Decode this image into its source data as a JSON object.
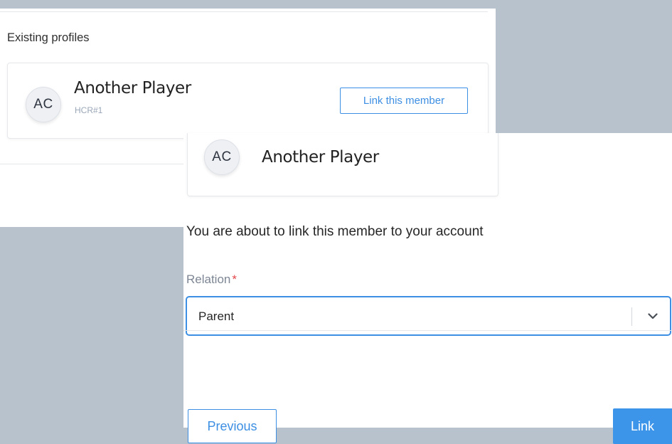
{
  "existing_profiles": {
    "section_title": "Existing profiles",
    "profile": {
      "initials": "AC",
      "name": "Another Player",
      "code": "HCR#1",
      "link_button_label": "Link this member"
    }
  },
  "link_modal": {
    "selected_member": {
      "initials": "AC",
      "name": "Another Player"
    },
    "message": "You are about to link this member to your account",
    "relation": {
      "label": "Relation",
      "required_marker": "*",
      "selected_value": "Parent",
      "dropdown_icon": "chevron-down-icon"
    },
    "buttons": {
      "previous": "Previous",
      "link": "Link"
    }
  },
  "colors": {
    "accent": "#3d8fe3",
    "required": "#e2474c",
    "backdrop": "#b8c2cc"
  }
}
